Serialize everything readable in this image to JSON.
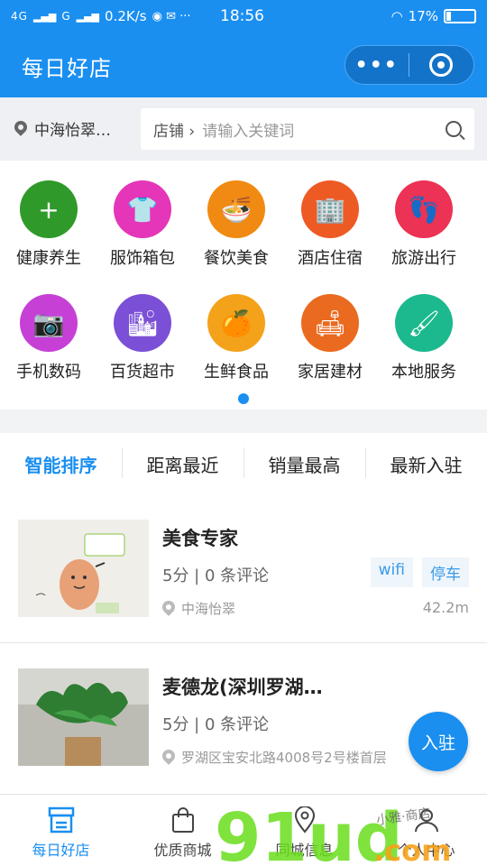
{
  "status": {
    "net1": "4G",
    "net2": "G",
    "speed": "0.2K/s",
    "time": "18:56",
    "battery": "17%"
  },
  "header": {
    "title": "每日好店"
  },
  "search": {
    "location": "中海怡翠…",
    "category": "店铺 ›",
    "placeholder": "请输入关键词"
  },
  "categories": [
    {
      "label": "健康养生",
      "color": "#2f9a2a",
      "icon": "plus-leaf-icon"
    },
    {
      "label": "服饰箱包",
      "color": "#e535b8",
      "icon": "tshirt-icon"
    },
    {
      "label": "餐饮美食",
      "color": "#f08a12",
      "icon": "noodle-bowl-icon"
    },
    {
      "label": "酒店住宿",
      "color": "#ee5a24",
      "icon": "building-icon"
    },
    {
      "label": "旅游出行",
      "color": "#ec3255",
      "icon": "footprint-icon"
    },
    {
      "label": "手机数码",
      "color": "#c640d6",
      "icon": "camera-icon"
    },
    {
      "label": "百货超市",
      "color": "#7b4fd6",
      "icon": "city-icon"
    },
    {
      "label": "生鲜食品",
      "color": "#f4a21a",
      "icon": "orange-icon"
    },
    {
      "label": "家居建材",
      "color": "#ea6a1f",
      "icon": "sofa-icon"
    },
    {
      "label": "本地服务",
      "color": "#1bb98d",
      "icon": "paint-roller-icon"
    }
  ],
  "sort_tabs": [
    "智能排序",
    "距离最近",
    "销量最高",
    "最新入驻"
  ],
  "stores": [
    {
      "name": "美食专家",
      "rating": "5分 | 0 条评论",
      "tags": [
        "wifi",
        "停车"
      ],
      "address": "中海怡翠",
      "distance": "42.2m"
    },
    {
      "name": "麦德龙(深圳罗湖…",
      "rating": "5分 | 0 条评论",
      "address": "罗湖区宝安北路4008号2号楼首层",
      "distance": ""
    }
  ],
  "join_button": "入驻",
  "nav": [
    {
      "label": "每日好店",
      "icon": "shop-icon"
    },
    {
      "label": "优质商城",
      "icon": "bag-icon"
    },
    {
      "label": "同城信息",
      "icon": "location-icon"
    },
    {
      "label": "个人中心",
      "icon": "user-icon"
    }
  ],
  "watermark": {
    "text": "91ud.com",
    "sub": "小雅·商店"
  }
}
